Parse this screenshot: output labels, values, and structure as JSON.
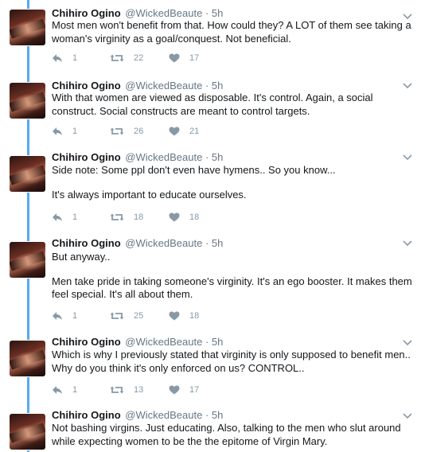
{
  "tweets": [
    {
      "name": "Chihiro Ogino",
      "handle": "@WickedBeaute",
      "separator": "·",
      "time": "5h",
      "paragraphs": [
        "Most men won't benefit from that. How could they? A LOT of them see taking a woman's virginity as a goal/conquest. Not beneficial."
      ],
      "replies": "1",
      "retweets": "22",
      "likes": "17"
    },
    {
      "name": "Chihiro Ogino",
      "handle": "@WickedBeaute",
      "separator": "·",
      "time": "5h",
      "paragraphs": [
        "With that women are viewed as disposable. It's control. Again, a social construct. Social constructs are meant to control targets."
      ],
      "replies": "1",
      "retweets": "26",
      "likes": "21"
    },
    {
      "name": "Chihiro Ogino",
      "handle": "@WickedBeaute",
      "separator": "·",
      "time": "5h",
      "paragraphs": [
        "Side note: Some ppl don't even have hymens.. So you know...",
        "It's always important to educate ourselves."
      ],
      "replies": "1",
      "retweets": "18",
      "likes": "18"
    },
    {
      "name": "Chihiro Ogino",
      "handle": "@WickedBeaute",
      "separator": "·",
      "time": "5h",
      "paragraphs": [
        "But anyway..",
        "Men take pride in taking someone's virginity. It's an ego booster. It makes them feel special. It's all about them."
      ],
      "replies": "1",
      "retweets": "25",
      "likes": "18"
    },
    {
      "name": "Chihiro Ogino",
      "handle": "@WickedBeaute",
      "separator": "·",
      "time": "5h",
      "paragraphs": [
        "Which is why I previously stated that virginity is only supposed to benefit men.. Why do you think it's only enforced on us? CONTROL.."
      ],
      "replies": "1",
      "retweets": "13",
      "likes": "17"
    },
    {
      "name": "Chihiro Ogino",
      "handle": "@WickedBeaute",
      "separator": "·",
      "time": "5h",
      "paragraphs": [
        "Not bashing virgins. Just educating. Also, talking to the men who slut around while expecting women to be the the epitome of Virgin Mary."
      ]
    }
  ],
  "icons": {
    "reply": "reply-icon",
    "retweet": "retweet-icon",
    "like": "heart-icon",
    "more": "chevron-down-icon",
    "avatar": "avatar"
  },
  "colors": {
    "thread_line": "#55acee",
    "icon_gray": "#8899a6",
    "text": "#14171a",
    "meta": "#657786"
  }
}
